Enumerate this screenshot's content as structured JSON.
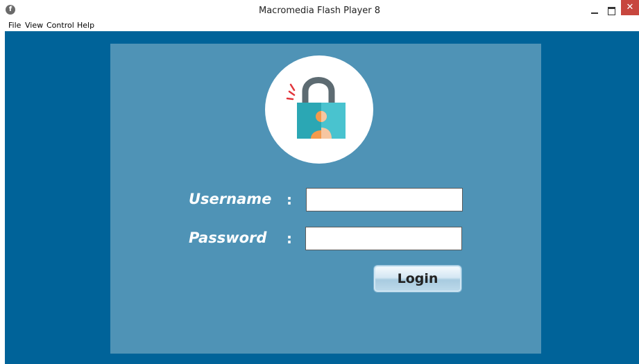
{
  "window": {
    "title": "Macromedia Flash Player 8",
    "icon": "flash-player-icon",
    "controls": {
      "minimize": "–",
      "maximize": "❐",
      "close": "✕"
    }
  },
  "menu": [
    "File",
    "View",
    "Control",
    "Help"
  ],
  "login_form": {
    "username_label": "Username",
    "password_label": "Password",
    "separator": ":",
    "username_value": "",
    "password_value": "",
    "login_button": "Login"
  },
  "colors": {
    "stage_background": "#006399",
    "panel_background": "#4f93b6",
    "close_button": "#c7463e"
  }
}
